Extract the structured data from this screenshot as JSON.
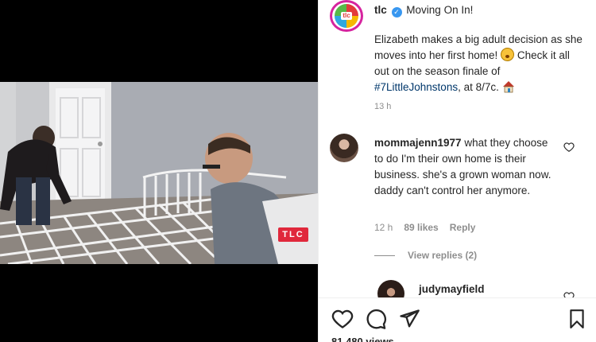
{
  "post": {
    "username": "tlc",
    "location": "Moving On In!",
    "caption_text": "Elizabeth makes a big adult decision as she moves into her first home! ",
    "caption_text2": " Check it all out on the season finale of ",
    "hashtag": "#7LittleJohnstons",
    "caption_end": ", at 8/7c. ",
    "timestamp": "13 h",
    "views": "81,480 views"
  },
  "video": {
    "watermark": "TLC"
  },
  "comments": [
    {
      "username": "mommajenn1977",
      "text": " what they choose to do I'm their own home is their business. she's a grown woman now. daddy can't control her anymore.",
      "time": "12 h",
      "likes": "89 likes",
      "reply": "Reply",
      "view_replies": "View replies (2)"
    },
    {
      "username": "judymayfield"
    }
  ],
  "icons": [
    "verified-badge-icon",
    "heart-icon",
    "comment-icon",
    "share-icon",
    "bookmark-icon"
  ]
}
